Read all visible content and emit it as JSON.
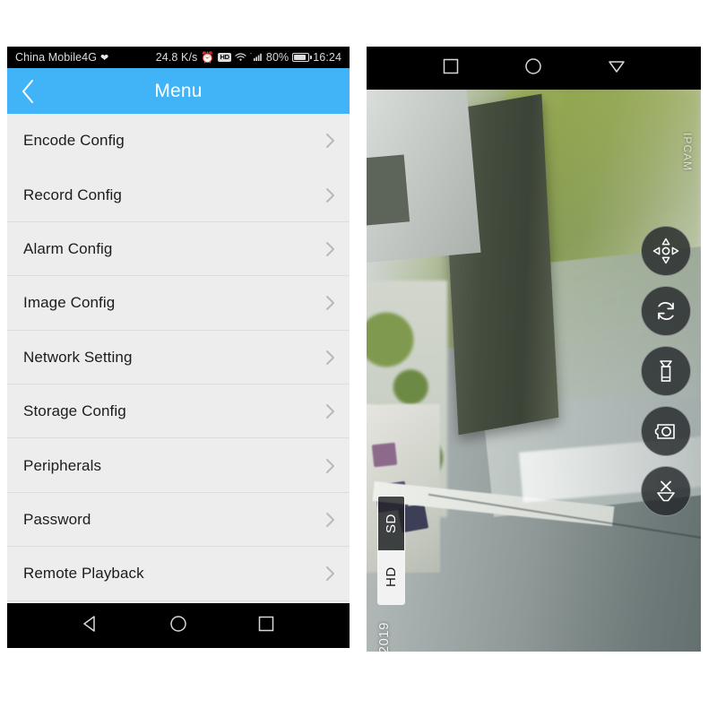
{
  "left_phone": {
    "status_bar": {
      "carrier": "China Mobile4G",
      "heart_icon": "heart-icon",
      "network_speed": "24.8 K/s",
      "alarm_icon": "alarm-clock-icon",
      "hd_badge": "HD",
      "wifi_icon": "wifi-icon",
      "signal_icon": "signal-bars-icon",
      "battery_percent": "80%",
      "battery_icon": "battery-icon",
      "time": "16:24"
    },
    "app_bar": {
      "back_icon": "chevron-left-icon",
      "title": "Menu",
      "background_color": "#41b4f7",
      "text_color": "#ffffff"
    },
    "menu": {
      "items": [
        {
          "label": "Encode Config",
          "arrow_icon": "chevron-right-icon"
        },
        {
          "label": "Record Config",
          "arrow_icon": "chevron-right-icon"
        },
        {
          "label": "Alarm Config",
          "arrow_icon": "chevron-right-icon"
        },
        {
          "label": "Image Config",
          "arrow_icon": "chevron-right-icon"
        },
        {
          "label": "Network Setting",
          "arrow_icon": "chevron-right-icon"
        },
        {
          "label": "Storage Config",
          "arrow_icon": "chevron-right-icon"
        },
        {
          "label": "Peripherals",
          "arrow_icon": "chevron-right-icon"
        },
        {
          "label": "Password",
          "arrow_icon": "chevron-right-icon"
        },
        {
          "label": "Remote Playback",
          "arrow_icon": "chevron-right-icon"
        }
      ],
      "row_background": "#ededed",
      "divider_color": "#dcdcdc"
    },
    "nav_bar": {
      "back_icon": "triangle-back-icon",
      "home_icon": "circle-home-icon",
      "recents_icon": "square-recents-icon"
    }
  },
  "right_phone": {
    "nav_bar": {
      "recents_icon": "square-recents-icon",
      "home_icon": "circle-home-icon",
      "back_icon": "triangle-back-icon"
    },
    "video": {
      "overlay_label": "IPCAM",
      "timestamp": "2019",
      "scene_description": "rotated outdoor camera view of pavement, concrete wall, mossy ground, trees and parked cars"
    },
    "controls": [
      {
        "name": "ptz-dpad-button",
        "icon": "dpad-icon"
      },
      {
        "name": "refresh-button",
        "icon": "refresh-icon"
      },
      {
        "name": "microphone-button",
        "icon": "microphone-icon"
      },
      {
        "name": "snapshot-button",
        "icon": "camera-icon"
      },
      {
        "name": "mute-button",
        "icon": "speaker-mute-icon"
      }
    ],
    "quality": {
      "options": [
        {
          "label": "SD",
          "selected": false
        },
        {
          "label": "HD",
          "selected": true
        }
      ]
    }
  }
}
